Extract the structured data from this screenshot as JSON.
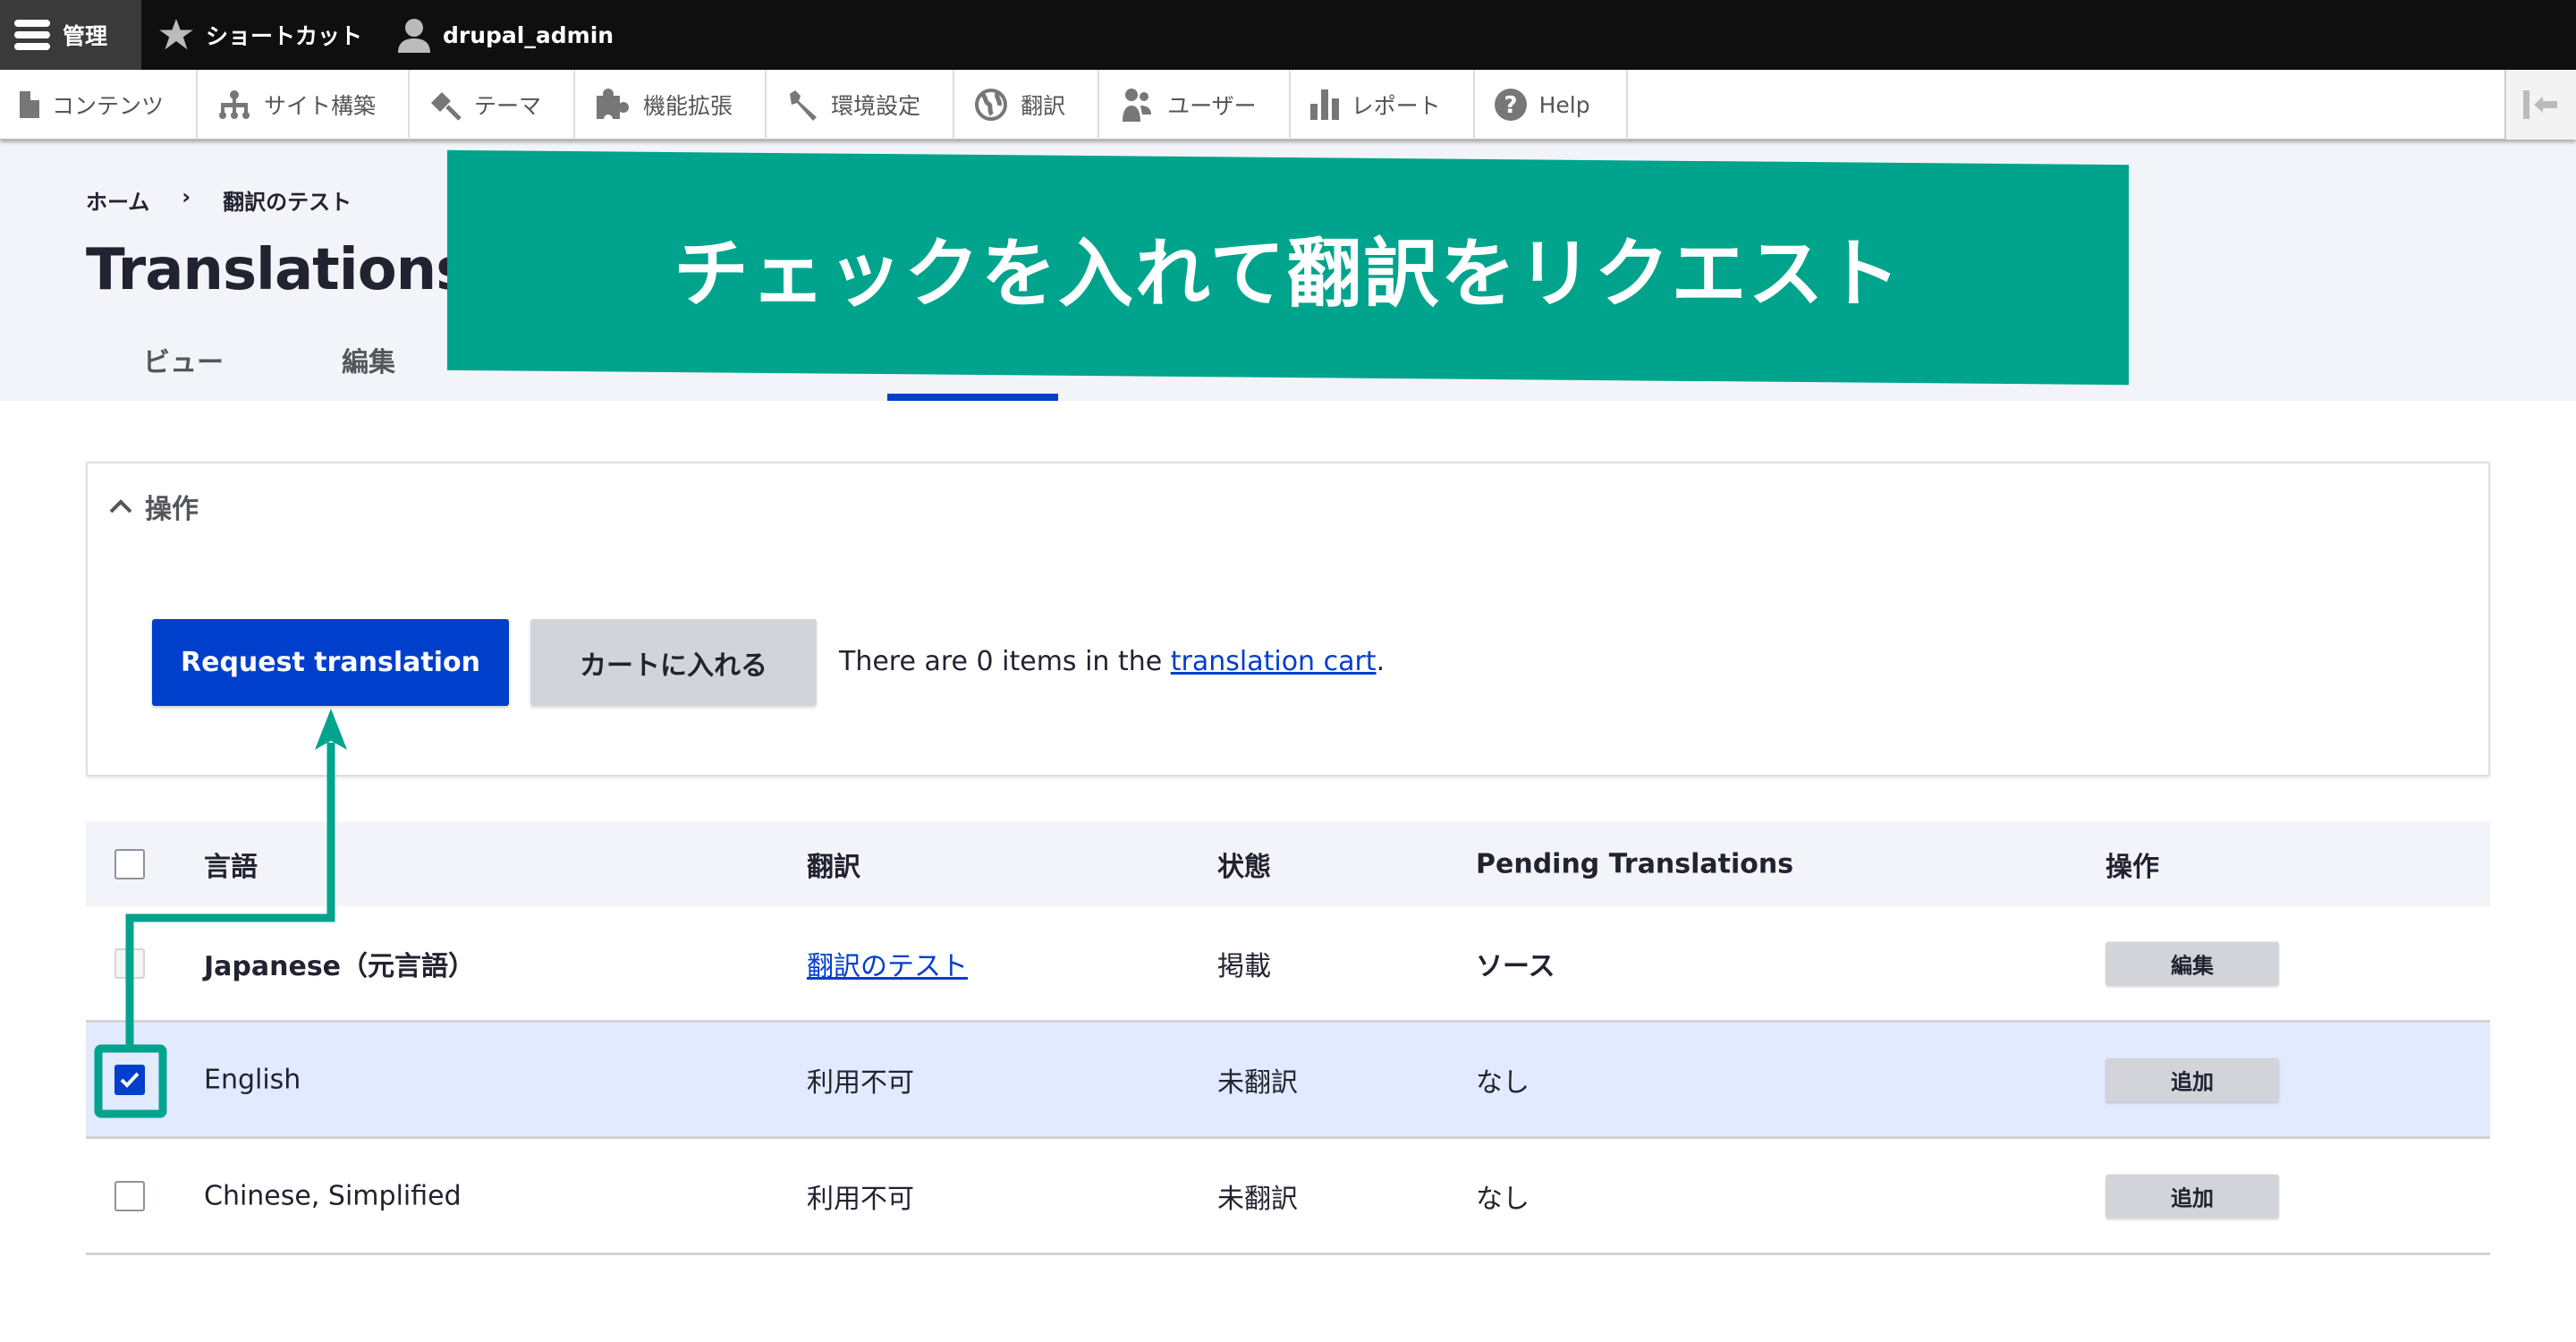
{
  "topbar": {
    "manage": "管理",
    "shortcuts": "ショートカット",
    "user": "drupal_admin"
  },
  "tray": {
    "items": [
      {
        "label": "コンテンツ",
        "icon": "file-icon"
      },
      {
        "label": "サイト構築",
        "icon": "sitemap-icon"
      },
      {
        "label": "テーマ",
        "icon": "paintbrush-icon"
      },
      {
        "label": "機能拡張",
        "icon": "puzzle-icon"
      },
      {
        "label": "環境設定",
        "icon": "wrench-icon"
      },
      {
        "label": "翻訳",
        "icon": "globe-icon"
      },
      {
        "label": "ユーザー",
        "icon": "people-icon"
      },
      {
        "label": "レポート",
        "icon": "bar-chart-icon"
      },
      {
        "label": "Help",
        "icon": "help-icon"
      }
    ]
  },
  "breadcrumb": {
    "home": "ホーム",
    "separator": "›",
    "current": "翻訳のテスト"
  },
  "page": {
    "title": "Translations of 翻訳のテスト"
  },
  "tabs": [
    {
      "label": "ビュー"
    },
    {
      "label": "編集"
    }
  ],
  "operations": {
    "summary": "操作",
    "request_button": "Request translation",
    "cart_button": "カートに入れる",
    "cart_text_pre": "There are 0 items in the ",
    "cart_link": "translation cart",
    "cart_text_post": "."
  },
  "table": {
    "headers": {
      "language": "言語",
      "translation": "翻訳",
      "status": "状態",
      "pending": "Pending Translations",
      "operations": "操作"
    },
    "rows": [
      {
        "language": "Japanese（元言語）",
        "translation": "翻訳のテスト",
        "status": "掲載",
        "pending": "ソース",
        "operation": "編集",
        "checked": false,
        "disabled": true
      },
      {
        "language": "English",
        "translation": "利用不可",
        "status": "未翻訳",
        "pending": "なし",
        "operation": "追加",
        "checked": true,
        "disabled": false
      },
      {
        "language": "Chinese, Simplified",
        "translation": "利用不可",
        "status": "未翻訳",
        "pending": "なし",
        "operation": "追加",
        "checked": false,
        "disabled": false
      }
    ]
  },
  "annotation": {
    "banner": "チェックを入れて翻訳をリクエスト",
    "color": "#00a48c"
  },
  "colors": {
    "primary": "#003ecc",
    "selected_row": "#e1eafe",
    "topbar": "#0f0f0f"
  }
}
